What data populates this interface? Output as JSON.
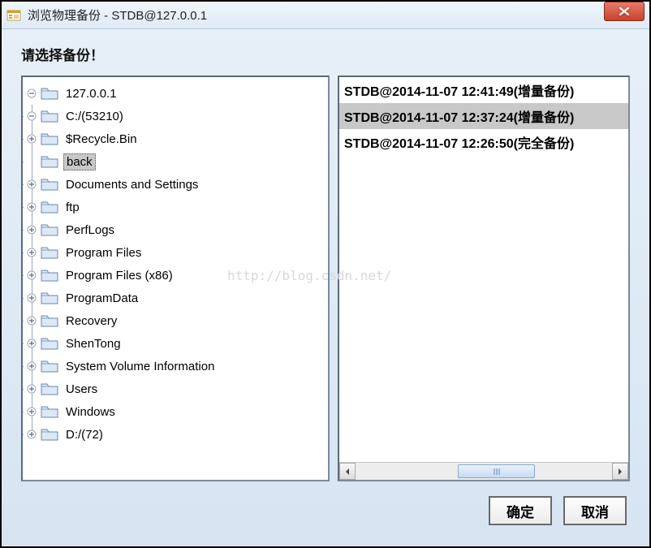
{
  "titlebar": {
    "title": "浏览物理备份  -  STDB@127.0.0.1"
  },
  "prompt": "请选择备份！",
  "tree": {
    "root": {
      "label": "127.0.0.1",
      "expanded": true,
      "children": [
        {
          "label": "C:/(53210)",
          "expanded": true,
          "children": [
            {
              "label": "$Recycle.Bin",
              "hasChildren": true
            },
            {
              "label": "back",
              "hasChildren": false,
              "selected": true
            },
            {
              "label": "Documents and Settings",
              "hasChildren": true
            },
            {
              "label": "ftp",
              "hasChildren": true
            },
            {
              "label": "PerfLogs",
              "hasChildren": true
            },
            {
              "label": "Program Files",
              "hasChildren": true
            },
            {
              "label": "Program Files (x86)",
              "hasChildren": true
            },
            {
              "label": "ProgramData",
              "hasChildren": true
            },
            {
              "label": "Recovery",
              "hasChildren": true
            },
            {
              "label": "ShenTong",
              "hasChildren": true
            },
            {
              "label": "System Volume Information",
              "hasChildren": true
            },
            {
              "label": "Users",
              "hasChildren": true
            },
            {
              "label": "Windows",
              "hasChildren": true
            }
          ]
        },
        {
          "label": "D:/(72)",
          "hasChildren": true
        }
      ]
    }
  },
  "backups": {
    "items": [
      {
        "label": "STDB@2014-11-07 12:41:49(增量备份)",
        "selected": false
      },
      {
        "label": "STDB@2014-11-07 12:37:24(增量备份)",
        "selected": true
      },
      {
        "label": "STDB@2014-11-07 12:26:50(完全备份)",
        "selected": false
      }
    ]
  },
  "buttons": {
    "ok": "确定",
    "cancel": "取消"
  },
  "watermark": "http://blog.csdn.net/"
}
